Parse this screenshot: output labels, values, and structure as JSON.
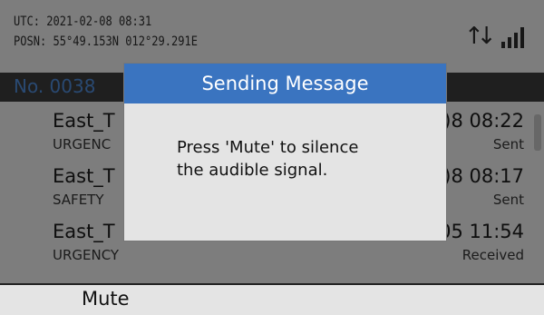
{
  "header": {
    "utc_line": "UTC:  2021-02-08  08:31",
    "posn_line": "POSN: 55°49.153N  012°29.291E",
    "icons": [
      "transfer-arrows-icon",
      "signal-strength-icon"
    ]
  },
  "list": {
    "number": "No. 0038",
    "rows": [
      {
        "name": "East_T",
        "category": "URGENC",
        "time": ")8 08:22",
        "status": "Sent"
      },
      {
        "name": "East_T",
        "category": "SAFETY",
        "time": ")8 08:17",
        "status": "Sent"
      },
      {
        "name": "East_T",
        "category": "URGENCY",
        "time": "05 11:54",
        "status": "Received"
      }
    ]
  },
  "dialog": {
    "title": "Sending Message",
    "body_line1": "Press 'Mute' to silence",
    "body_line2": "the audible signal."
  },
  "softkeys": {
    "mute_label": "Mute"
  },
  "colors": {
    "dialog_title_bg": "#3a74c0",
    "list_title_text": "#4c86d0",
    "screen_bg": "#e4e4e4"
  }
}
